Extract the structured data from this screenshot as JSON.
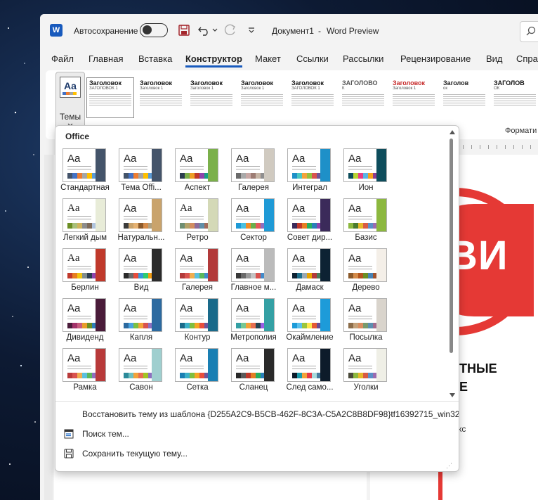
{
  "window": {
    "autosave_label": "Автосохранение",
    "doc_title": "Документ1",
    "app_name": "Word Preview",
    "separator": "-"
  },
  "menu": {
    "items": [
      "Файл",
      "Главная",
      "Вставка",
      "Конструктор",
      "Макет",
      "Ссылки",
      "Рассылки",
      "Рецензирование",
      "Вид",
      "Справ"
    ],
    "active_index": 3
  },
  "ribbon": {
    "themes_label": "Темы",
    "themes_icon_text": "Aa",
    "format_label": "Формати",
    "style_gallery": [
      {
        "title": "Заголовок",
        "sub": "ЗАГОЛОВОК 1",
        "color": "#111"
      },
      {
        "title": "Заголовок",
        "sub": "Заголовок 1",
        "color": "#111"
      },
      {
        "title": "Заголовок",
        "sub": "Заголовок 1",
        "color": "#111"
      },
      {
        "title": "Заголовок",
        "sub": "Заголовок 1",
        "color": "#111"
      },
      {
        "title": "Заголовок",
        "sub": "ЗАГОЛОВОК 1",
        "color": "#111"
      },
      {
        "title": "ЗАГОЛОВО",
        "sub": "К",
        "color": "#555"
      },
      {
        "title": "Заголовок",
        "sub": "Заголовок 1",
        "color": "#c62828"
      },
      {
        "title": "Заголов",
        "sub": "ок",
        "color": "#222"
      },
      {
        "title": "ЗАГОЛОВ",
        "sub": "ОК",
        "color": "#111"
      }
    ]
  },
  "themes_dropdown": {
    "header": "Office",
    "themes": [
      {
        "name": "Стандартная",
        "font": "Liberation Sans",
        "accent": "#44546a",
        "swatches": [
          "#44546a",
          "#4472c4",
          "#ed7d31",
          "#a5a5a5",
          "#ffc000",
          "#5b9bd5"
        ]
      },
      {
        "name": "Тема Offi...",
        "font": "Liberation Sans",
        "accent": "#44546a",
        "swatches": [
          "#44546a",
          "#4472c4",
          "#ed7d31",
          "#a5a5a5",
          "#ffc000",
          "#5b9bd5"
        ]
      },
      {
        "name": "Аспект",
        "font": "Liberation Sans",
        "accent": "#7bb04b",
        "swatches": [
          "#2c3e50",
          "#7bb04b",
          "#ed9e25",
          "#c0392b",
          "#8e44ad",
          "#16a085"
        ]
      },
      {
        "name": "Галерея",
        "font": "Liberation Sans",
        "accent": "#d0cac0",
        "swatches": [
          "#6b6b6b",
          "#a9a9a9",
          "#c9a9a6",
          "#9d7c73",
          "#c7b6a6",
          "#8f8f8f"
        ]
      },
      {
        "name": "Интеграл",
        "font": "Liberation Sans",
        "accent": "#1e90c8",
        "swatches": [
          "#1e90c8",
          "#4ac7c0",
          "#f2a33a",
          "#96c03e",
          "#d9534f",
          "#6f5499"
        ]
      },
      {
        "name": "Ион",
        "font": "Liberation Sans",
        "accent": "#0e4d5c",
        "swatches": [
          "#0e4d5c",
          "#b8d432",
          "#e83d84",
          "#5cb4e5",
          "#f6a21e",
          "#8e3b8f"
        ]
      },
      {
        "name": "Легкий дым",
        "font": "Liberation Serif",
        "accent": "#e8ecd8",
        "swatches": [
          "#6b8e23",
          "#a9c07a",
          "#d0b45e",
          "#8c8c8c",
          "#7e6b5a",
          "#b0c4de"
        ]
      },
      {
        "name": "Натуральн...",
        "font": "Liberation Sans",
        "accent": "#c9a36c",
        "swatches": [
          "#3c3c3c",
          "#c9a36c",
          "#e6b272",
          "#8b5a2b",
          "#d48b4a",
          "#b0a080"
        ]
      },
      {
        "name": "Ретро",
        "font": "Liberation Serif",
        "accent": "#d4d9b7",
        "swatches": [
          "#6f8f72",
          "#b3a369",
          "#d28d60",
          "#8e6c9a",
          "#5f8ea8",
          "#a26b5b"
        ]
      },
      {
        "name": "Сектор",
        "font": "Liberation Sans",
        "accent": "#1f9ad6",
        "swatches": [
          "#1f9ad6",
          "#4ac0e0",
          "#f28c28",
          "#6ab04c",
          "#e55b5b",
          "#8e6fbf"
        ]
      },
      {
        "name": "Совет дир...",
        "font": "Liberation Sans",
        "accent": "#3b2a5a",
        "swatches": [
          "#3b2a5a",
          "#c0392b",
          "#e67e22",
          "#27ae60",
          "#2980b9",
          "#8e44ad"
        ]
      },
      {
        "name": "Базис",
        "font": "Liberation Sans",
        "accent": "#8cb83f",
        "swatches": [
          "#8cb83f",
          "#4a7c2f",
          "#e6b82a",
          "#d95b43",
          "#5b8fc7",
          "#9b6bb0"
        ]
      },
      {
        "name": "Берлин",
        "font": "Liberation Serif",
        "accent": "#c0392b",
        "swatches": [
          "#c0392b",
          "#e67e22",
          "#f1c40f",
          "#7f8c8d",
          "#2c3e50",
          "#8e44ad"
        ]
      },
      {
        "name": "Вид",
        "font": "Liberation Sans",
        "accent": "#2b2b2b",
        "swatches": [
          "#2b2b2b",
          "#6b6b6b",
          "#e74c3c",
          "#3498db",
          "#2ecc71",
          "#f39c12"
        ]
      },
      {
        "name": "Галерея",
        "font": "Liberation Sans",
        "accent": "#b23a3a",
        "swatches": [
          "#b23a3a",
          "#d9534f",
          "#f0ad4e",
          "#5bc0de",
          "#5cb85c",
          "#428bca"
        ]
      },
      {
        "name": "Главное м...",
        "font": "Liberation Sans",
        "accent": "#bbbbbb",
        "swatches": [
          "#3a3a3a",
          "#6b6b6b",
          "#9b9b9b",
          "#c3c3c3",
          "#d9534f",
          "#428bca"
        ]
      },
      {
        "name": "Дамаск",
        "font": "Liberation Sans",
        "accent": "#0d2233",
        "swatches": [
          "#0d2233",
          "#1f6f8b",
          "#99a8b2",
          "#e6a400",
          "#b33a3a",
          "#4a7c59"
        ]
      },
      {
        "name": "Дерево",
        "font": "Liberation Sans",
        "accent": "#f4efe8",
        "swatches": [
          "#8b5a2b",
          "#d48b4a",
          "#b3541e",
          "#6b8e23",
          "#4682b4",
          "#a0522d"
        ]
      },
      {
        "name": "Дивиденд",
        "font": "Liberation Sans",
        "accent": "#4a1c3a",
        "swatches": [
          "#4a1c3a",
          "#a3326a",
          "#c75c7c",
          "#e89c2a",
          "#6b8e23",
          "#2c7fb8"
        ]
      },
      {
        "name": "Капля",
        "font": "Liberation Sans",
        "accent": "#2c6aa0",
        "swatches": [
          "#2c6aa0",
          "#4aa3df",
          "#7ac143",
          "#f2a33a",
          "#d9534f",
          "#8e6fbf"
        ]
      },
      {
        "name": "Контур",
        "font": "Liberation Sans",
        "accent": "#1a6a8a",
        "swatches": [
          "#1a6a8a",
          "#3ab0c8",
          "#7fbf3f",
          "#f5a623",
          "#e94e3c",
          "#6f5499"
        ]
      },
      {
        "name": "Метрополия",
        "font": "Liberation Sans",
        "accent": "#34a0a4",
        "swatches": [
          "#34a0a4",
          "#76c893",
          "#f2a33a",
          "#e76f51",
          "#264653",
          "#9b5de5"
        ]
      },
      {
        "name": "Окаймление",
        "font": "Liberation Sans",
        "accent": "#1d9bd9",
        "swatches": [
          "#1d9bd9",
          "#5bc0eb",
          "#9bc53d",
          "#fde74c",
          "#e55934",
          "#6a4c93"
        ]
      },
      {
        "name": "Посылка",
        "font": "Liberation Sans",
        "accent": "#d9d4cc",
        "swatches": [
          "#8c6d4a",
          "#c4a27a",
          "#d98c5f",
          "#7a9a6b",
          "#5b8fb0",
          "#a06b8f"
        ]
      },
      {
        "name": "Рамка",
        "font": "Liberation Sans",
        "accent": "#b83a3a",
        "swatches": [
          "#b83a3a",
          "#d9534f",
          "#f0ad4e",
          "#5bc0de",
          "#5cb85c",
          "#8e6fbf"
        ]
      },
      {
        "name": "Савон",
        "font": "Liberation Sans",
        "accent": "#9fcfcf",
        "swatches": [
          "#2b8a9a",
          "#6fc0c0",
          "#f2a33a",
          "#e76f51",
          "#a2c523",
          "#8e6fbf"
        ]
      },
      {
        "name": "Сетка",
        "font": "Liberation Sans",
        "accent": "#1a7fb3",
        "swatches": [
          "#1a7fb3",
          "#3ab0c8",
          "#7fbf3f",
          "#f5a623",
          "#e94e3c",
          "#6f5499"
        ]
      },
      {
        "name": "Сланец",
        "font": "Liberation Sans",
        "accent": "#2a2a2a",
        "swatches": [
          "#2a2a2a",
          "#5a5a5a",
          "#c0392b",
          "#e67e22",
          "#27ae60",
          "#2980b9"
        ]
      },
      {
        "name": "След само...",
        "font": "Liberation Sans",
        "accent": "#0d1b2a",
        "swatches": [
          "#0d1b2a",
          "#1b9aaa",
          "#f2a33a",
          "#e63946",
          "#a8dadc",
          "#457b9d"
        ]
      },
      {
        "name": "Уголки",
        "font": "Liberation Sans",
        "accent": "#efefe6",
        "swatches": [
          "#4a4a3a",
          "#8cb83f",
          "#e6b82a",
          "#d95b43",
          "#5b8fc7",
          "#9b6bb0"
        ]
      }
    ],
    "actions": [
      {
        "label": "Восстановить тему из шаблона {D255A2C9-B5CB-462F-8C3A-C5A2C8B8DF98}tf16392715_win32",
        "icon": "none"
      },
      {
        "label": "Поиск тем...",
        "icon": "browse-icon"
      },
      {
        "label": "Сохранить текущую тему...",
        "icon": "save-icon"
      }
    ]
  },
  "document": {
    "big_text": "ВИ",
    "heading_line1": "ТНЫЕ",
    "heading_line2": "Е",
    "small_text": "кс"
  }
}
